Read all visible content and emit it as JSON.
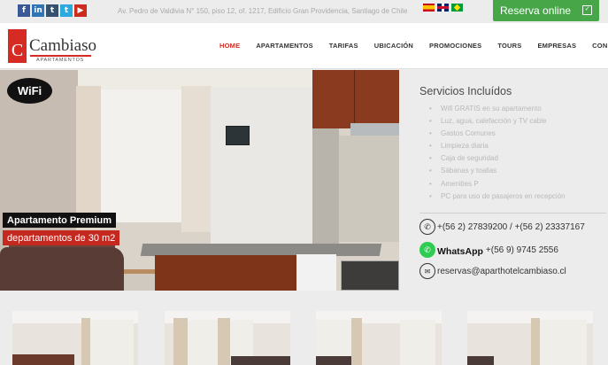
{
  "topbar": {
    "social_icons": [
      "facebook-icon",
      "linkedin-icon",
      "tumblr-icon",
      "twitter-icon",
      "youtube-icon"
    ],
    "social_glyphs": [
      "f",
      "in",
      "t",
      "t",
      "▶"
    ],
    "address": "Av. Pedro de Valdivia N° 150, piso 12, of. 1217, Edificio Gran Providencia, Santiago de Chile",
    "languages": [
      "es",
      "en",
      "pt"
    ],
    "reserve_label": "Reserva online"
  },
  "header": {
    "logo_name": "Cambiaso",
    "logo_sub": "APARTAMENTOS",
    "logo_letter": "C",
    "nav": [
      "HOME",
      "APARTAMENTOS",
      "TARIFAS",
      "UBICACIÓN",
      "PROMOCIONES",
      "TOURS",
      "EMPRESAS",
      "CONSULTA"
    ],
    "active_nav": "HOME"
  },
  "hero": {
    "wifi_badge": "WiFi",
    "title": "Apartamento Premium",
    "subtitle": "departamentos de 30 m2"
  },
  "services": {
    "heading": "Servicios Incluídos",
    "items": [
      "Wifi GRATIS en su apartamento",
      "Luz, agua, calefacción y TV cable",
      "Gastos Comunes",
      "Limpieza diaria",
      "Caja de seguridad",
      "Sábanas y toallas",
      "Amenities P",
      "PC para uso de pasajeros en recepción"
    ],
    "phone": "+(56 2) 27839200 / +(56 2) 23337167",
    "whatsapp_label": "WhatsApp",
    "whatsapp_number": "+(56 9) 9745 2556",
    "email": "reservas@aparthotelcambiaso.cl"
  },
  "colors": {
    "brand_red": "#d62b22",
    "reserve_green": "#47a748",
    "whatsapp_green": "#2ecc52"
  }
}
